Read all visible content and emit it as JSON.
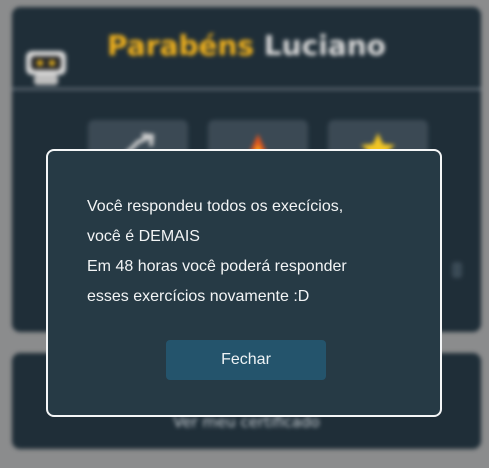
{
  "background": {
    "title_accent": "Parabéns",
    "title_name": "Luciano",
    "certificate_link": "Ver meu certificado",
    "tiles": [
      {
        "icon": "arrow-trend-icon"
      },
      {
        "icon": "fire-icon"
      },
      {
        "icon": "star-icon"
      }
    ]
  },
  "modal": {
    "lines": [
      "Você respondeu todos os execícios,",
      "você é DEMAIS",
      "Em 48 horas você poderá responder",
      "esses exercícios novamente :D"
    ],
    "close_label": "Fechar"
  },
  "colors": {
    "accent": "#f2b21c",
    "panel": "#1f2e38",
    "modal_bg": "#263a45",
    "button": "#24546c"
  }
}
